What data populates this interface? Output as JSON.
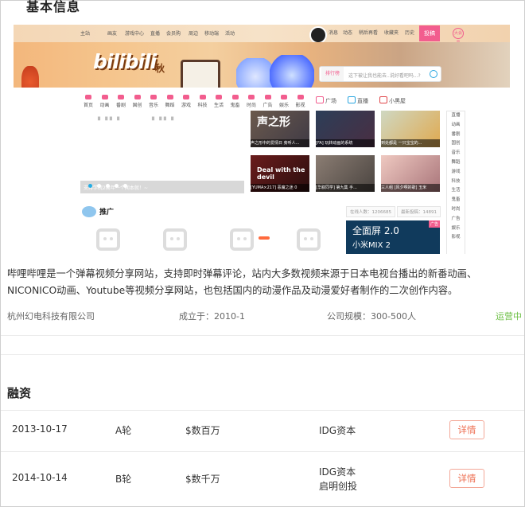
{
  "section_basic": {
    "title": "基本信息"
  },
  "screenshot": {
    "topbar": {
      "left_items": [
        "主站",
        "画友",
        "游戏中心",
        "直播",
        "会员购",
        "周边",
        "移动端",
        "活动"
      ],
      "right_items": [
        "消息",
        "动态",
        "稍后再看",
        "收藏夹",
        "历史"
      ],
      "contribute": "投稿",
      "badge": "大会员"
    },
    "banner": {
      "logo_text": "bilibili",
      "logo_suffix": "秋"
    },
    "search": {
      "rank_label": "排行榜",
      "placeholder": "这下被让我也能去..说好看吧吗...?"
    },
    "nav_items": [
      "首页",
      "动画",
      "番剧",
      "国创",
      "音乐",
      "舞蹈",
      "游戏",
      "科技",
      "生活",
      "鬼畜",
      "时尚",
      "广告",
      "娱乐",
      "影视"
    ],
    "nav_extra": [
      "广场",
      "直播",
      "小黑屋"
    ],
    "carousel_caption": "支持学院2周年一个闻本就！~",
    "thumbnails": [
      {
        "big": "声之形",
        "caption": "声之形中的爱情日 旁听人..."
      },
      {
        "big": "",
        "caption": "[FA] 玩转动画的系统"
      },
      {
        "big": "",
        "caption": "到处都是 一只宝宝的..."
      },
      {
        "big": "Deal with the devil",
        "caption": "[YUMA×217] 恶魔之迷 0"
      },
      {
        "big": "",
        "caption": "[华叙同学] 第九集 手..."
      },
      {
        "big": "",
        "caption": "三人组 [风夕啊的歌] 玉米"
      }
    ],
    "side_items": [
      "直播",
      "动画",
      "番剧",
      "国创",
      "音乐",
      "舞蹈",
      "游戏",
      "科技",
      "生活",
      "鬼畜",
      "时尚",
      "广告",
      "娱乐",
      "影视"
    ],
    "promo_label": "推广",
    "stats": [
      "在线人数：1206685",
      "最新投稿：14891"
    ],
    "ad": {
      "line1": "全面屏 2.0",
      "line2": "小米MIX 2",
      "tag": "广告"
    }
  },
  "description": "哔哩哔哩是一个弹幕视频分享网站，支持即时弹幕评论，站内大多数视频来源于日本电视台播出的新番动画、NICONICO动画、Youtube等视频分享网站，也包括国内的动漫作品及动漫爱好者制作的二次创作内容。",
  "meta": {
    "company": "杭州幻电科技有限公司",
    "founded": "成立于：2010-1",
    "scale": "公司规模：300-500人",
    "status": "运营中"
  },
  "section_finance": {
    "title": "融资"
  },
  "financing": [
    {
      "date": "2013-10-17",
      "round": "A轮",
      "amount": "$数百万",
      "investors": [
        "IDG资本"
      ],
      "detail": "详情"
    },
    {
      "date": "2014-10-14",
      "round": "B轮",
      "amount": "$数千万",
      "investors": [
        "IDG资本",
        "启明创投"
      ],
      "detail": "详情"
    }
  ]
}
